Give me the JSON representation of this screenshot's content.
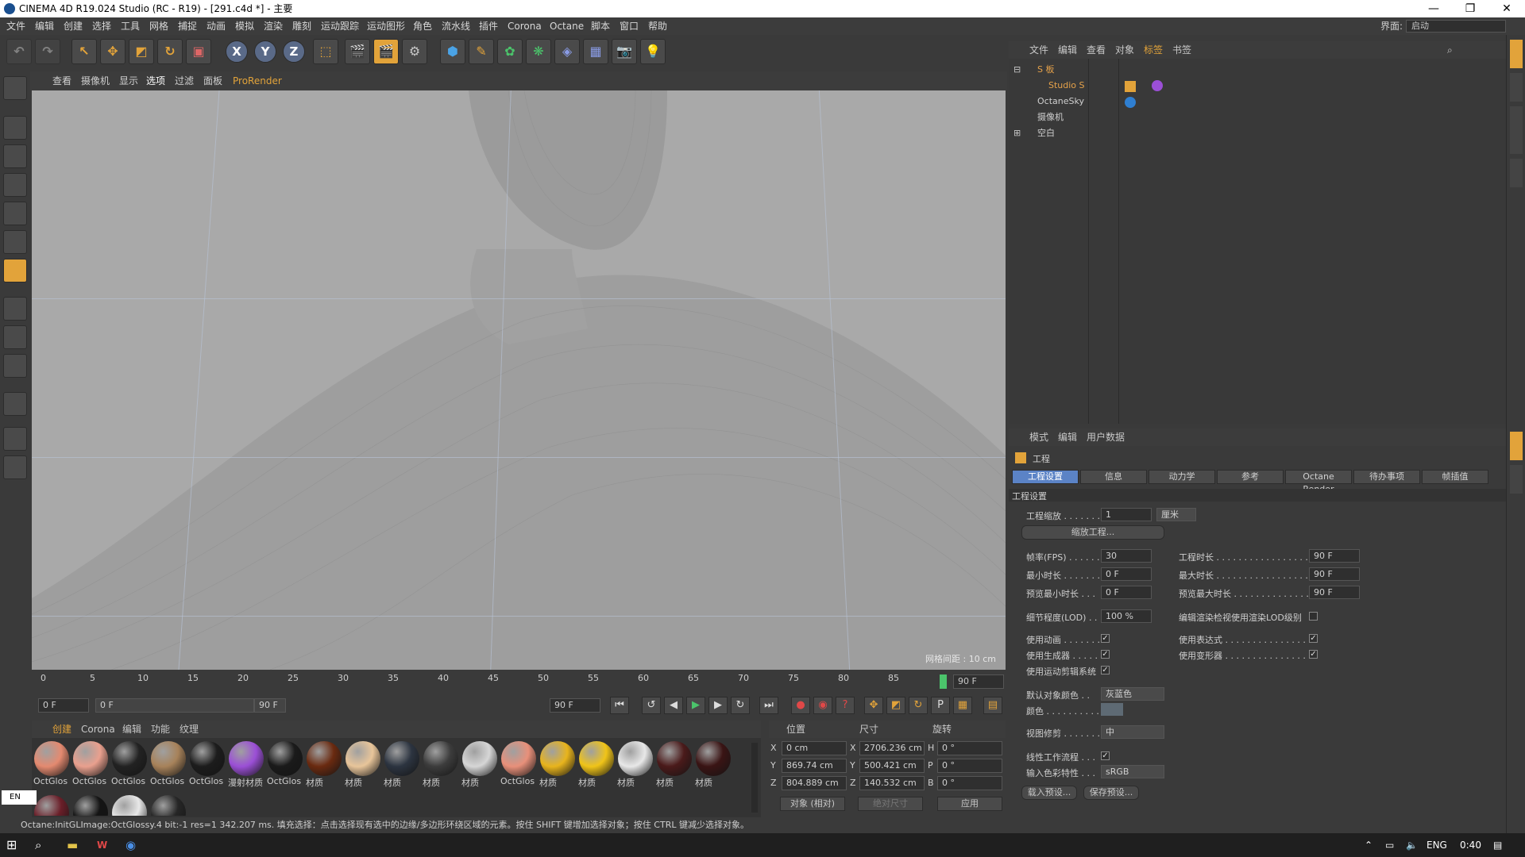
{
  "window": {
    "title": "CINEMA 4D R19.024 Studio (RC - R19) - [291.c4d *] - 主要"
  },
  "menubar": {
    "items": [
      "文件",
      "编辑",
      "创建",
      "选择",
      "工具",
      "网格",
      "捕捉",
      "动画",
      "模拟",
      "渲染",
      "雕刻",
      "运动跟踪",
      "运动图形",
      "角色",
      "流水线",
      "插件",
      "Corona",
      "Octane",
      "脚本",
      "窗口",
      "帮助"
    ],
    "layout_label": "界面:",
    "layout_value": "启动"
  },
  "toolbar": {
    "axis_x": "X",
    "axis_y": "Y",
    "axis_z": "Z"
  },
  "viewport": {
    "menu": [
      "查看",
      "摄像机",
      "显示",
      "选项",
      "过滤",
      "面板",
      "ProRender"
    ],
    "scale_info": "网格间距 : 10 cm"
  },
  "timeline": {
    "ticks": [
      "0",
      "5",
      "10",
      "15",
      "20",
      "25",
      "30",
      "35",
      "40",
      "45",
      "50",
      "55",
      "60",
      "65",
      "70",
      "75",
      "80",
      "85"
    ],
    "end_frame": "90 F"
  },
  "transport": {
    "current_frame": "0 F",
    "range_start": "0 F",
    "range_end": "90 F",
    "max_frame": "90 F"
  },
  "materials": {
    "menu": [
      "创建",
      "Corona",
      "编辑",
      "功能",
      "纹理"
    ],
    "items": [
      {
        "label": "OctGlos",
        "color": "#e48a70"
      },
      {
        "label": "OctGlos",
        "color": "#e9a08e"
      },
      {
        "label": "OctGlos",
        "color": "#222222"
      },
      {
        "label": "OctGlos",
        "color": "#a7825a"
      },
      {
        "label": "OctGlos",
        "color": "#1c1c1c"
      },
      {
        "label": "漫射材质",
        "color": "#9b4fd6"
      },
      {
        "label": "OctGlos",
        "color": "#1a1a1a"
      },
      {
        "label": "材质",
        "color": "#6a2a10"
      },
      {
        "label": "材质",
        "color": "#e8c59a"
      },
      {
        "label": "材质",
        "color": "#2c3440"
      },
      {
        "label": "材质",
        "color": "#3c3c3c"
      },
      {
        "label": "材质",
        "color": "#d6d6d6"
      },
      {
        "label": "OctGlos",
        "color": "#e8907a"
      },
      {
        "label": "材质",
        "color": "#e8b41c"
      },
      {
        "label": "材质",
        "color": "#f0c418"
      },
      {
        "label": "材质",
        "color": "#e8e8e8"
      },
      {
        "label": "材质",
        "color": "#4a1a1a"
      },
      {
        "label": "材质",
        "color": "#3a1414"
      }
    ],
    "row2": [
      {
        "label": "",
        "color": "#6a1e28"
      },
      {
        "label": "",
        "color": "#141414"
      },
      {
        "label": "",
        "color": "#e8e8e8"
      },
      {
        "label": "",
        "color": "#262626"
      }
    ]
  },
  "coords": {
    "head": [
      "位置",
      "尺寸",
      "旋转"
    ],
    "pos": {
      "x": "0 cm",
      "y": "869.74 cm",
      "z": "804.889 cm"
    },
    "size": {
      "x": "2706.236 cm",
      "y": "500.421 cm",
      "z": "140.532 cm"
    },
    "rot": {
      "h": "0 °",
      "p": "0 °",
      "b": "0 °"
    },
    "labels": {
      "x": "X",
      "y": "Y",
      "z": "Z",
      "h": "H",
      "p": "P",
      "b": "B"
    },
    "mode": "对象 (相对)",
    "size_mode": "绝对尺寸",
    "apply": "应用"
  },
  "status": {
    "text": "Octane:InitGLImage:OctGlossy.4  bit:-1 res=1  342.207 ms.      填充选择：点击选择现有选中的边缘/多边形环绕区域的元素。按住 SHIFT 键增加选择对象；按住 CTRL 键减少选择对象。"
  },
  "objects": {
    "menu": [
      "文件",
      "编辑",
      "查看",
      "对象",
      "标签",
      "书签"
    ],
    "rows": [
      {
        "name": "S 板",
        "color": "#e6a24a"
      },
      {
        "name": "Studio S",
        "color": "#e6a24a"
      },
      {
        "name": "OctaneSky",
        "color": "#cfcfcf"
      },
      {
        "name": "摄像机",
        "color": "#cfcfcf"
      },
      {
        "name": "空白",
        "color": "#cfcfcf"
      }
    ]
  },
  "attributes": {
    "menu": [
      "模式",
      "编辑",
      "用户数据"
    ],
    "header": "工程",
    "tabs": [
      "工程设置",
      "信息",
      "动力学",
      "参考",
      "Octane Render",
      "待办事项",
      "帧插值"
    ],
    "section": "工程设置",
    "scale_label": "工程缩放 . . . . . . .",
    "scale_value": "1",
    "scale_unit": "厘米",
    "scale_btn": "缩放工程...",
    "fps_label": "帧率(FPS) . . . . . .",
    "fps_value": "30",
    "min_label": "最小时长 . . . . . . . .",
    "min_value": "0 F",
    "pmin_label": "预览最小时长 . . .",
    "pmin_value": "0 F",
    "proj_len_label": "工程时长 . . . . . . . . . . . . . . . . . .",
    "proj_len_value": "90 F",
    "max_label": "最大时长 . . . . . . . . . . . . . . . . . .",
    "max_value": "90 F",
    "pmax_label": "预览最大时长 . . . . . . . . . . . . . . .",
    "pmax_value": "90 F",
    "lod_label": "细节程度(LOD) . .",
    "lod_value": "100 %",
    "lod_check_label": "编辑渲染检视使用渲染LOD级别",
    "use_anim": "使用动画 . . . . . . . .",
    "use_expr": "使用表达式 . . . . . . . . . . . . . . . .",
    "use_gen": "使用生成器 . . . . . . .",
    "use_deform": "使用变形器 . . . . . . . . . . . . . . . .",
    "use_motion": "使用运动剪辑系统",
    "def_color_label": "默认对象颜色 . .",
    "def_color_value": "灰蓝色",
    "color_label": "颜色 . . . . . . . . . . .",
    "view_clip_label": "视图修剪 . . . . . . .",
    "view_clip_value": "中",
    "linear_label": "线性工作流程 . . .",
    "input_color_label": "输入色彩特性 . . .",
    "input_color_value": "sRGB",
    "load_preset": "载入预设...",
    "save_preset": "保存预设..."
  },
  "taskbar": {
    "lang": "ENG",
    "time": "0:40",
    "ime": "EN"
  }
}
